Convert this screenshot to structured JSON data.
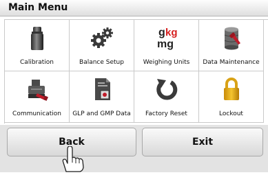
{
  "window": {
    "title": "Main Menu"
  },
  "menu": {
    "items": [
      {
        "label": "Calibration",
        "icon": "calibration-weight-icon"
      },
      {
        "label": "Balance Setup",
        "icon": "gears-icon"
      },
      {
        "label": "Weighing Units",
        "icon": "weighing-units-icon"
      },
      {
        "label": "Data Maintenance",
        "icon": "database-icon"
      },
      {
        "label": "Communication",
        "icon": "communication-printer-icon"
      },
      {
        "label": "GLP and GMP Data",
        "icon": "glp-document-icon"
      },
      {
        "label": "Factory Reset",
        "icon": "reset-arrow-icon"
      },
      {
        "label": "Lockout",
        "icon": "padlock-icon"
      }
    ]
  },
  "units_icon": {
    "top": "g",
    "top_suffix": "kg",
    "bottom": "mg"
  },
  "buttons": {
    "back": "Back",
    "exit": "Exit"
  }
}
